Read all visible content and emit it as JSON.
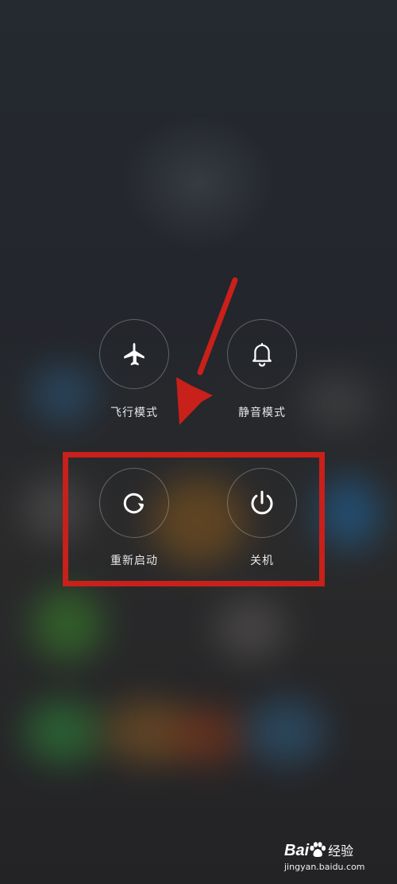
{
  "power_menu": {
    "buttons": [
      {
        "label": "飞行模式",
        "icon": "airplane-icon"
      },
      {
        "label": "静音模式",
        "icon": "bell-icon"
      },
      {
        "label": "重新启动",
        "icon": "restart-icon"
      },
      {
        "label": "关机",
        "icon": "power-icon"
      }
    ]
  },
  "annotation": {
    "color": "#c8201a",
    "highlighted_buttons": [
      "重新启动",
      "关机"
    ]
  },
  "watermark": {
    "logo_part1": "Bai",
    "logo_part2": "经验",
    "site": "jingyan.baidu.com"
  }
}
